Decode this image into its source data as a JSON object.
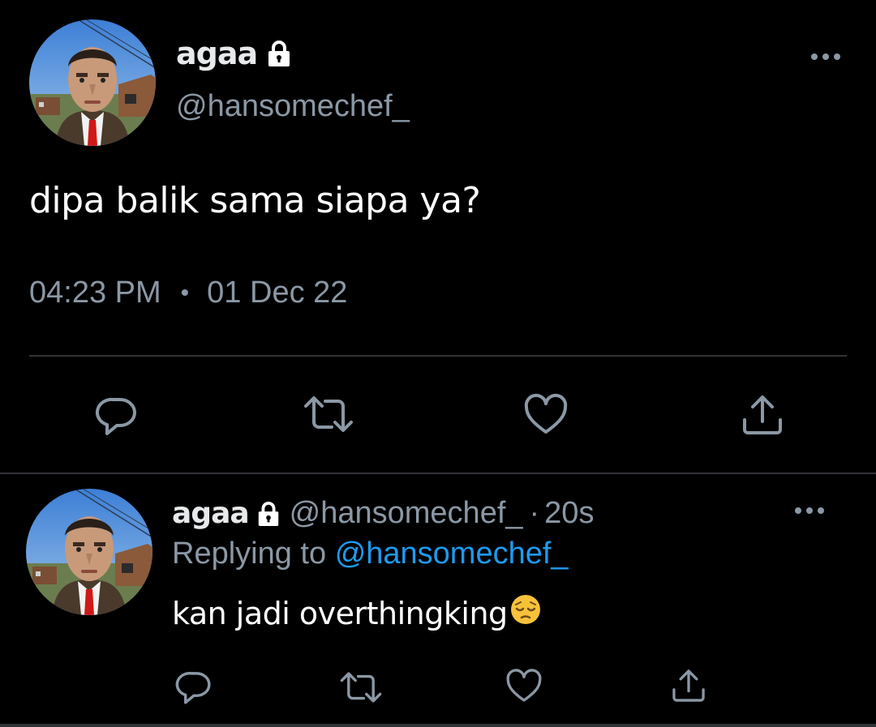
{
  "main_tweet": {
    "display_name": "agaa",
    "handle": "@hansomechef_",
    "text": "dipa balik sama siapa ya?",
    "time": "04:23 PM",
    "date": "01 Dec 22",
    "icons": {
      "lock": "lock-icon",
      "more": "more-icon",
      "reply": "reply-icon",
      "retweet": "retweet-icon",
      "like": "heart-icon",
      "share": "share-icon"
    }
  },
  "reply_tweet": {
    "display_name": "agaa",
    "handle": "@hansomechef_",
    "separator": "·",
    "time_ago": "20s",
    "replying_to_label": "Replying to",
    "replying_to_handle": "@hansomechef_",
    "text": "kan jadi overthingking",
    "emoji": "pensive-face-icon"
  },
  "colors": {
    "background": "#000000",
    "text_primary": "#e7e9ea",
    "text_secondary": "#8b98a5",
    "accent_link": "#1d9bf0",
    "divider": "#2f3336"
  }
}
